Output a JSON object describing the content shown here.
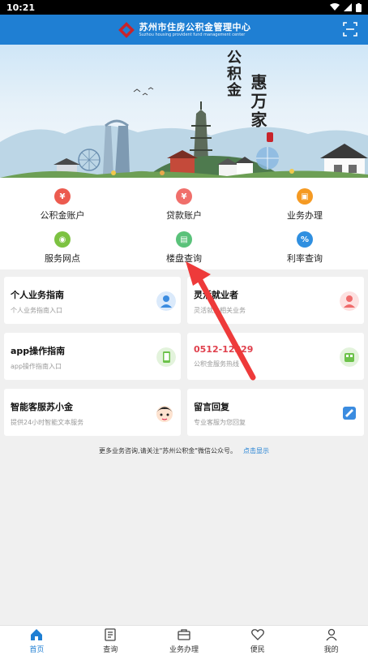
{
  "status_bar": {
    "time": "10:21"
  },
  "header": {
    "title_cn": "苏州市住房公积金管理中心",
    "title_en": "Suzhou housing provident fund management center"
  },
  "banner": {
    "slogan_left": "公积金",
    "slogan_right": "惠万家"
  },
  "grid": [
    {
      "label": "公积金账户",
      "icon": "wallet-icon",
      "color": "#ec5b4f"
    },
    {
      "label": "贷款账户",
      "icon": "loan-icon",
      "color": "#f06f6b"
    },
    {
      "label": "业务办理",
      "icon": "briefcase-icon",
      "color": "#f59a23"
    },
    {
      "label": "服务网点",
      "icon": "location-icon",
      "color": "#7cc241"
    },
    {
      "label": "楼盘查询",
      "icon": "building-icon",
      "color": "#5ac27a"
    },
    {
      "label": "利率查询",
      "icon": "rate-icon",
      "color": "#2f8fe0"
    }
  ],
  "cards": [
    {
      "title": "个人业务指南",
      "sub": "个人业务指南入口",
      "icon": "person-icon"
    },
    {
      "title": "灵活就业者",
      "sub": "灵活就业相关业务",
      "icon": "worker-icon"
    },
    {
      "title": "app操作指南",
      "sub": "app操作指南入口",
      "icon": "phone-guide-icon"
    },
    {
      "title": "0512-12329",
      "sub": "公积金服务热线",
      "icon": "telephone-icon"
    },
    {
      "title": "智能客服苏小金",
      "sub": "提供24小时智能文本服务",
      "icon": "robot-avatar-icon"
    },
    {
      "title": "留言回复",
      "sub": "专业客服为您回复",
      "icon": "edit-note-icon"
    }
  ],
  "notice": {
    "text": "更多业务咨询,请关注\"苏州公积金\"微信公众号。",
    "link": "点击显示"
  },
  "tabs": [
    {
      "label": "首页",
      "icon": "home-icon",
      "active": true
    },
    {
      "label": "查询",
      "icon": "query-icon",
      "active": false
    },
    {
      "label": "业务办理",
      "icon": "briefcase-icon",
      "active": false
    },
    {
      "label": "便民",
      "icon": "heart-icon",
      "active": false
    },
    {
      "label": "我的",
      "icon": "user-icon",
      "active": false
    }
  ],
  "colors": {
    "primary": "#1f7fd3",
    "phone_red": "#e0404d",
    "arrow": "#ee3a3a"
  }
}
